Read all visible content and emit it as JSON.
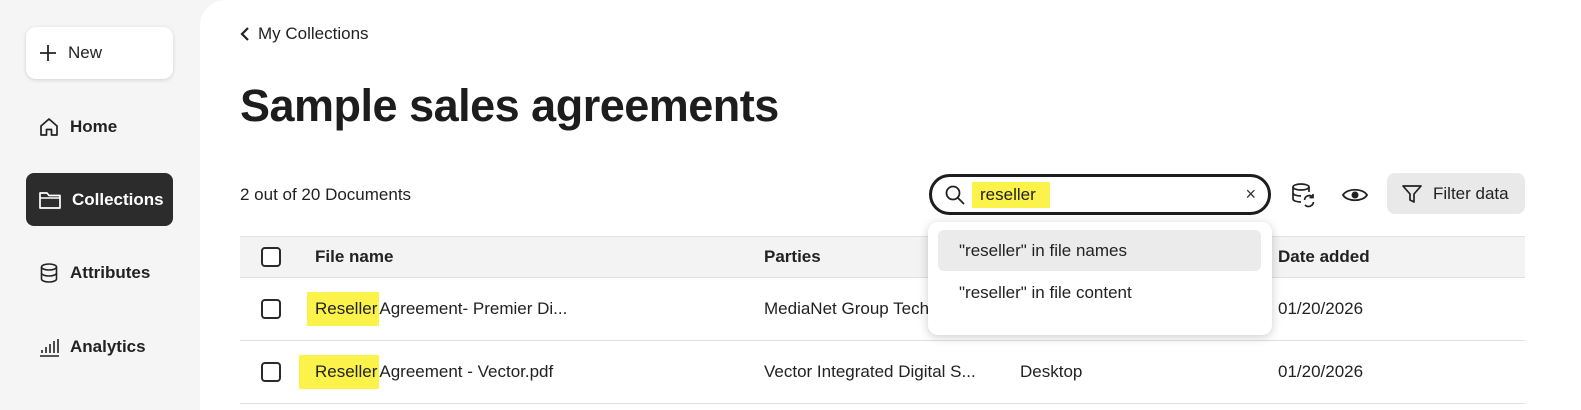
{
  "sidebar": {
    "new_label": "New",
    "items": [
      {
        "label": "Home"
      },
      {
        "label": "Collections"
      },
      {
        "label": "Attributes"
      },
      {
        "label": "Analytics"
      }
    ]
  },
  "header": {
    "back_label": "My Collections",
    "title": "Sample sales agreements"
  },
  "toolbar": {
    "doc_count": "2 out of 20 Documents",
    "search_value": "reseller",
    "clear_symbol": "×",
    "filter_label": "Filter data"
  },
  "search_suggestions": [
    "\"reseller\" in file names",
    "\"reseller\" in file content"
  ],
  "table": {
    "columns": [
      "File name",
      "Parties",
      "Date added"
    ],
    "rows": [
      {
        "file_highlight": "Reseller",
        "file_rest": " Agreement- Premier Di...",
        "parties": "MediaNet Group Tech",
        "source": "",
        "date": "01/20/2026"
      },
      {
        "file_highlight": "Reseller",
        "file_rest": " Agreement - Vector.pdf",
        "parties": "Vector Integrated Digital S...",
        "source": "Desktop",
        "date": "01/20/2026"
      }
    ]
  },
  "colors": {
    "highlight": "#fbf34a",
    "active_nav": "#2c2c2c"
  },
  "icons": [
    "plus-icon",
    "home-icon",
    "folder-icon",
    "database-icon",
    "bar-chart-icon",
    "chevron-left-icon",
    "search-icon",
    "database-sync-icon",
    "eye-icon",
    "filter-icon"
  ]
}
